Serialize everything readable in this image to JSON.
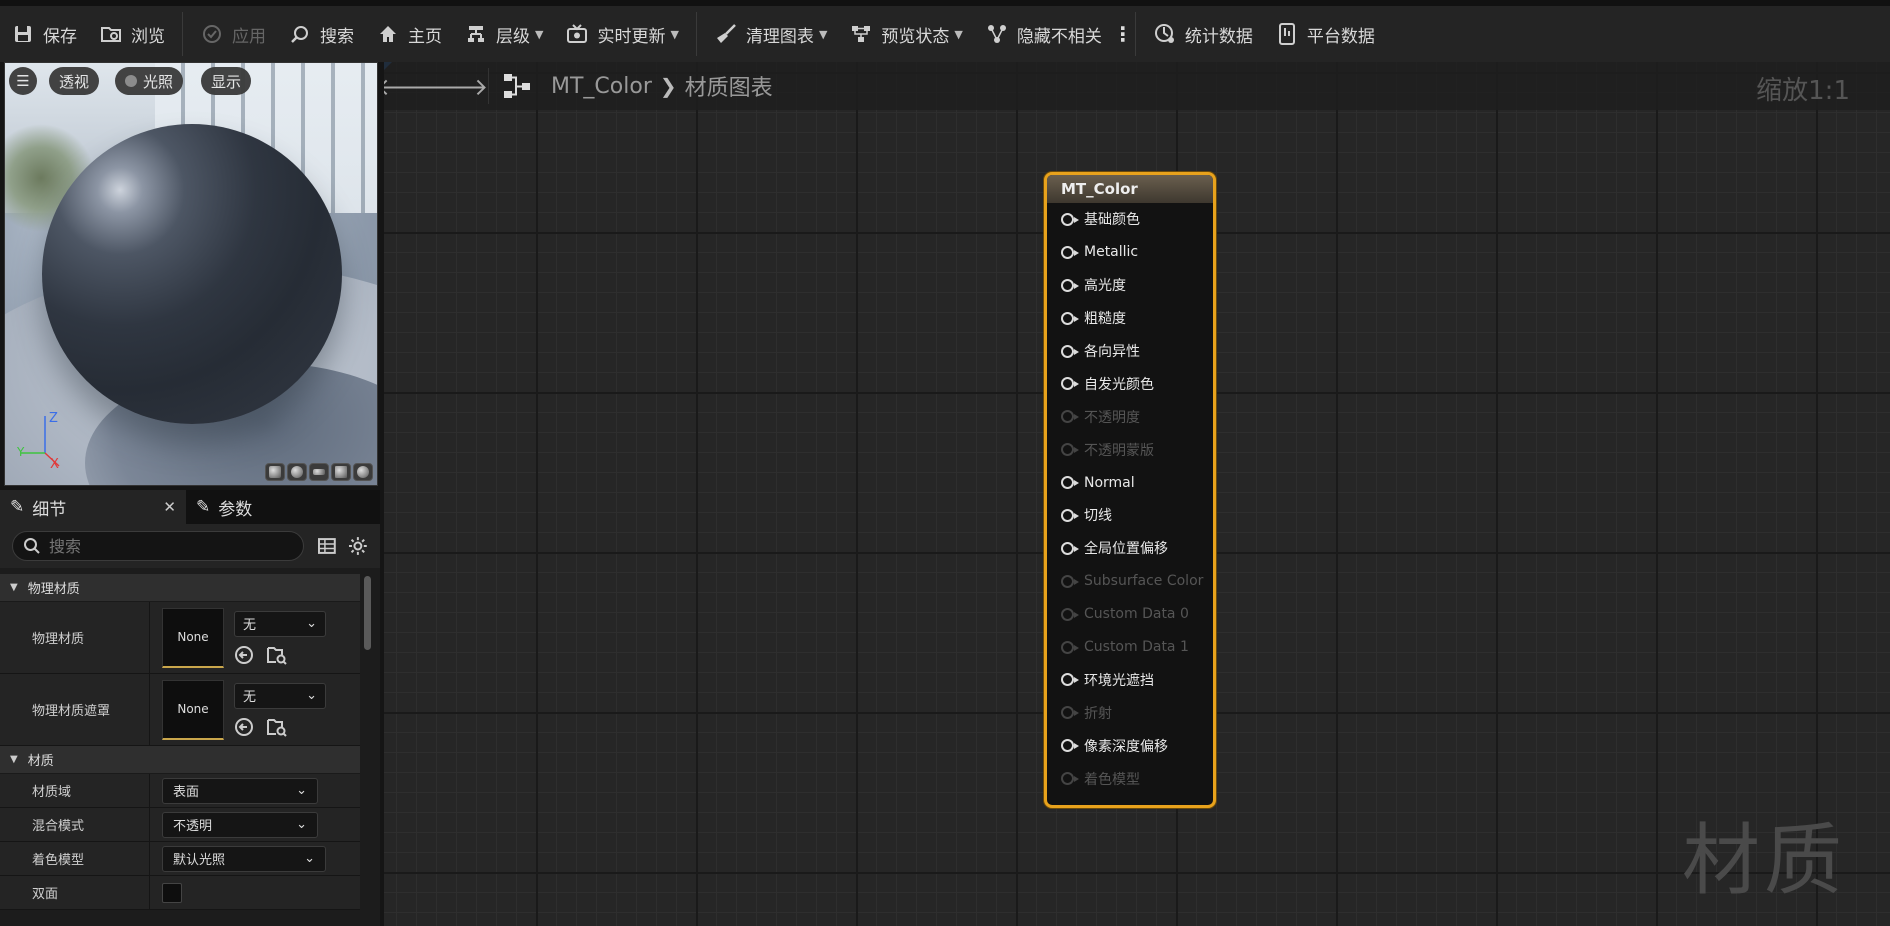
{
  "toolbar": {
    "save": "保存",
    "browse": "浏览",
    "apply": "应用",
    "search": "搜索",
    "home": "主页",
    "hierarchy": "层级",
    "live_update": "实时更新",
    "clean_graph": "清理图表",
    "preview_state": "预览状态",
    "hide_unrelated": "隐藏不相关",
    "stats": "统计数据",
    "platform_stats": "平台数据"
  },
  "viewport": {
    "perspective": "透视",
    "lighting": "光照",
    "show": "显示",
    "axis_z": "Z",
    "axis_x": "X",
    "axis_y": "Y"
  },
  "details": {
    "tab_details": "细节",
    "tab_params": "参数",
    "search_placeholder": "搜索",
    "cat_physical": "物理材质",
    "phys_mat_label": "物理材质",
    "phys_mat_value": "None",
    "phys_mat_dd": "无",
    "phys_mask_label": "物理材质遮罩",
    "phys_mask_value": "None",
    "phys_mask_dd": "无",
    "cat_material": "材质",
    "domain_label": "材质域",
    "domain_value": "表面",
    "blend_label": "混合模式",
    "blend_value": "不透明",
    "shading_label": "着色模型",
    "shading_value": "默认光照",
    "twosided_label": "双面"
  },
  "graph": {
    "crumb_asset": "MT_Color",
    "crumb_graph": "材质图表",
    "zoom": "缩放1:1",
    "watermark": "材质"
  },
  "node": {
    "title": "MT_Color",
    "pins": [
      {
        "label": "基础颜色",
        "enabled": true
      },
      {
        "label": "Metallic",
        "enabled": true
      },
      {
        "label": "高光度",
        "enabled": true
      },
      {
        "label": "粗糙度",
        "enabled": true
      },
      {
        "label": "各向异性",
        "enabled": true
      },
      {
        "label": "自发光颜色",
        "enabled": true
      },
      {
        "label": "不透明度",
        "enabled": false
      },
      {
        "label": "不透明蒙版",
        "enabled": false
      },
      {
        "label": "Normal",
        "enabled": true
      },
      {
        "label": "切线",
        "enabled": true
      },
      {
        "label": "全局位置偏移",
        "enabled": true
      },
      {
        "label": "Subsurface Color",
        "enabled": false
      },
      {
        "label": "Custom Data 0",
        "enabled": false
      },
      {
        "label": "Custom Data 1",
        "enabled": false
      },
      {
        "label": "环境光遮挡",
        "enabled": true
      },
      {
        "label": "折射",
        "enabled": false
      },
      {
        "label": "像素深度偏移",
        "enabled": true
      },
      {
        "label": "着色模型",
        "enabled": false
      }
    ]
  },
  "colors": {
    "node_border": "#e8a21c",
    "accent_blue": "#2a7de1",
    "thumb_underline": "#c9a64b"
  }
}
